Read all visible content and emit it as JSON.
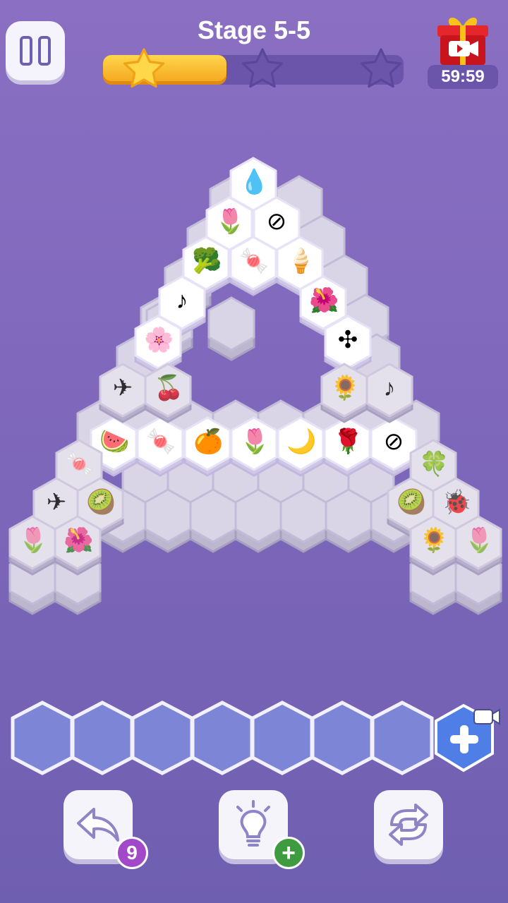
{
  "header": {
    "stage_title": "Stage 5-5",
    "timer": "59:59",
    "stars_earned": 1,
    "stars_total": 3,
    "progress_fraction": 0.41
  },
  "icons": {
    "pause": "pause-icon",
    "gift": "gift-video-icon",
    "undo": "undo-arrow-icon",
    "hint": "lightbulb-icon",
    "shuffle": "shuffle-icon",
    "add_slot": "add-slot-video-icon"
  },
  "board": {
    "tiles": [
      {
        "icon": "💧",
        "name": "blue-flame-tile",
        "layer": 4
      },
      {
        "icon": "🌷",
        "name": "tulip-tile",
        "layer": 4
      },
      {
        "icon": "⊘",
        "name": "plate-tile",
        "layer": 4
      },
      {
        "icon": "🥦",
        "name": "broccoli-tile",
        "layer": 4
      },
      {
        "icon": "🍬",
        "name": "candy-tile",
        "layer": 4
      },
      {
        "icon": "🍦",
        "name": "ice-cream-tile",
        "layer": 4
      },
      {
        "icon": "♪",
        "name": "music-note-tile",
        "layer": 4
      },
      {
        "icon": "🌺",
        "name": "morning-glory-tile",
        "layer": 4
      },
      {
        "icon": "🌸",
        "name": "lily-tile",
        "layer": 4
      },
      {
        "icon": "✣",
        "name": "pinwheel-tile",
        "layer": 4
      },
      {
        "icon": "🍉",
        "name": "watermelon-tile",
        "layer": 4
      },
      {
        "icon": "🍬",
        "name": "candy-stick-tile",
        "layer": 4
      },
      {
        "icon": "🍊",
        "name": "orange-tile",
        "layer": 4
      },
      {
        "icon": "🌷",
        "name": "tulip-tile",
        "layer": 4
      },
      {
        "icon": "🌙",
        "name": "moon-tile",
        "layer": 4
      },
      {
        "icon": "🌹",
        "name": "rose-tile",
        "layer": 4
      },
      {
        "icon": "⊘",
        "name": "plate-tile",
        "layer": 4
      },
      {
        "icon": "✈",
        "name": "paper-plane-tile",
        "layer": 3
      },
      {
        "icon": "🍒",
        "name": "cherries-tile",
        "layer": 3
      },
      {
        "icon": "🌻",
        "name": "sunflower-tile",
        "layer": 3
      },
      {
        "icon": "♪",
        "name": "music-note-tile",
        "layer": 3
      },
      {
        "icon": "🍬",
        "name": "candy-tile",
        "layer": 3
      },
      {
        "icon": "🍀",
        "name": "clover-tile",
        "layer": 3
      },
      {
        "icon": "✈",
        "name": "paper-plane-tile",
        "layer": 3
      },
      {
        "icon": "🥝",
        "name": "kiwi-tile",
        "layer": 3
      },
      {
        "icon": "🥝",
        "name": "kiwi-tile",
        "layer": 3
      },
      {
        "icon": "🐞",
        "name": "ladybug-tile",
        "layer": 3
      },
      {
        "icon": "🌷",
        "name": "tulip-tile",
        "layer": 3
      },
      {
        "icon": "🌺",
        "name": "morning-glory-tile",
        "layer": 3
      },
      {
        "icon": "🌻",
        "name": "sunflower-tile",
        "layer": 3
      },
      {
        "icon": "🌷",
        "name": "tulip-tile",
        "layer": 3
      }
    ]
  },
  "slots": {
    "count": 7,
    "filled": 0
  },
  "tools": {
    "undo_count": "9"
  }
}
